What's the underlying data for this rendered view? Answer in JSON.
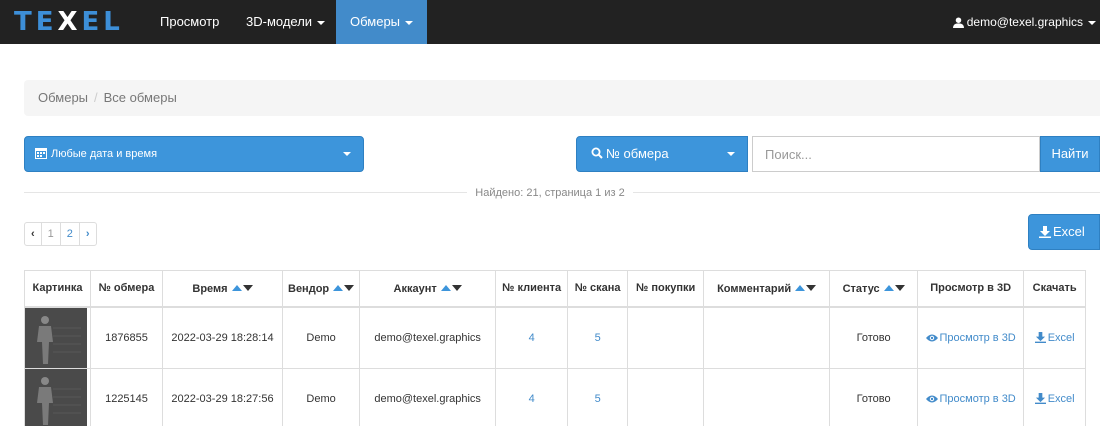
{
  "brand": {
    "logo_text_left": "TE",
    "logo_text_x": "X",
    "logo_text_right": "EL"
  },
  "nav": [
    {
      "label": "Просмотр",
      "dropdown": false,
      "active": false
    },
    {
      "label": "3D-модели",
      "dropdown": true,
      "active": false
    },
    {
      "label": "Обмеры",
      "dropdown": true,
      "active": true
    }
  ],
  "user": {
    "email": "demo@texel.graphics"
  },
  "breadcrumb": {
    "parent": "Обмеры",
    "separator": "/",
    "current": "Все обмеры"
  },
  "filters": {
    "date_label": "Любые дата и время",
    "search_type_label": "№ обмера",
    "search_placeholder": "Поиск...",
    "find_label": "Найти"
  },
  "found_text": "Найдено: 21, страница 1 из 2",
  "pagination": {
    "prev": "‹",
    "pages": [
      "1",
      "2"
    ],
    "current": "1",
    "next": "›"
  },
  "excel_label": "Excel",
  "table": {
    "headers": [
      "Картинка",
      "№ обмера",
      "Время",
      "Вендор",
      "Аккаунт",
      "№ клиента",
      "№ скана",
      "№ покупки",
      "Комментарий",
      "Статус",
      "Просмотр в 3D",
      "Скачать"
    ],
    "sortable": [
      "Время",
      "Вендор",
      "Аккаунт",
      "Комментарий",
      "Статус"
    ],
    "rows": [
      {
        "id": "1876855",
        "time": "2022-03-29 18:28:14",
        "vendor": "Demo",
        "account": "demo@texel.graphics",
        "client": "4",
        "scan": "5",
        "purchase": "",
        "comment": "",
        "status": "Готово",
        "view3d": "Просмотр в 3D",
        "download": "Excel"
      },
      {
        "id": "1225145",
        "time": "2022-03-29 18:27:56",
        "vendor": "Demo",
        "account": "demo@texel.graphics",
        "client": "4",
        "scan": "5",
        "purchase": "",
        "comment": "",
        "status": "Готово",
        "view3d": "Просмотр в 3D",
        "download": "Excel"
      }
    ]
  },
  "colors": {
    "accent": "#3d95db",
    "navbar": "#222222",
    "link": "#428bca"
  }
}
